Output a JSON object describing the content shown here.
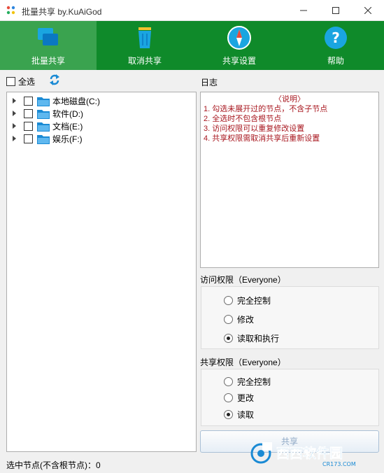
{
  "window": {
    "title": "批量共享 by.KuAiGod"
  },
  "toolbar": {
    "buttons": [
      {
        "label": "批量共享",
        "icon": "batch-share-icon",
        "active": true
      },
      {
        "label": "取消共享",
        "icon": "trash-icon",
        "active": false
      },
      {
        "label": "共享设置",
        "icon": "compass-icon",
        "active": false
      },
      {
        "label": "帮助",
        "icon": "help-icon",
        "active": false
      }
    ],
    "active_bg": "#3aa34f",
    "bg": "#0f8a2a"
  },
  "tree_panel": {
    "select_all_label": "全选",
    "select_all_checked": false,
    "items": [
      {
        "label": "本地磁盘(C:)",
        "checked": false
      },
      {
        "label": "软件(D:)",
        "checked": false
      },
      {
        "label": "文档(E:)",
        "checked": false
      },
      {
        "label": "娱乐(F:)",
        "checked": false
      }
    ]
  },
  "log": {
    "title": "日志",
    "header": "〈说明〉",
    "lines": [
      "1. 勾选未展开过的节点，不含子节点",
      "2. 全选时不包含根节点",
      "3. 访问权限可以重复修改设置",
      "4. 共享权限需取消共享后重新设置"
    ],
    "text_color": "#a8171f"
  },
  "access": {
    "title": "访问权限（Everyone）",
    "options": [
      "完全控制",
      "修改",
      "读取和执行"
    ],
    "selected": 2
  },
  "share_perm": {
    "title": "共享权限（Everyone）",
    "options": [
      "完全控制",
      "更改",
      "读取"
    ],
    "selected": 2
  },
  "share_button": {
    "label": "共享"
  },
  "status": {
    "text": "选中节点(不含根节点)：0"
  },
  "watermark": {
    "text": "西西软件园",
    "subtext": "CR173.COM"
  }
}
